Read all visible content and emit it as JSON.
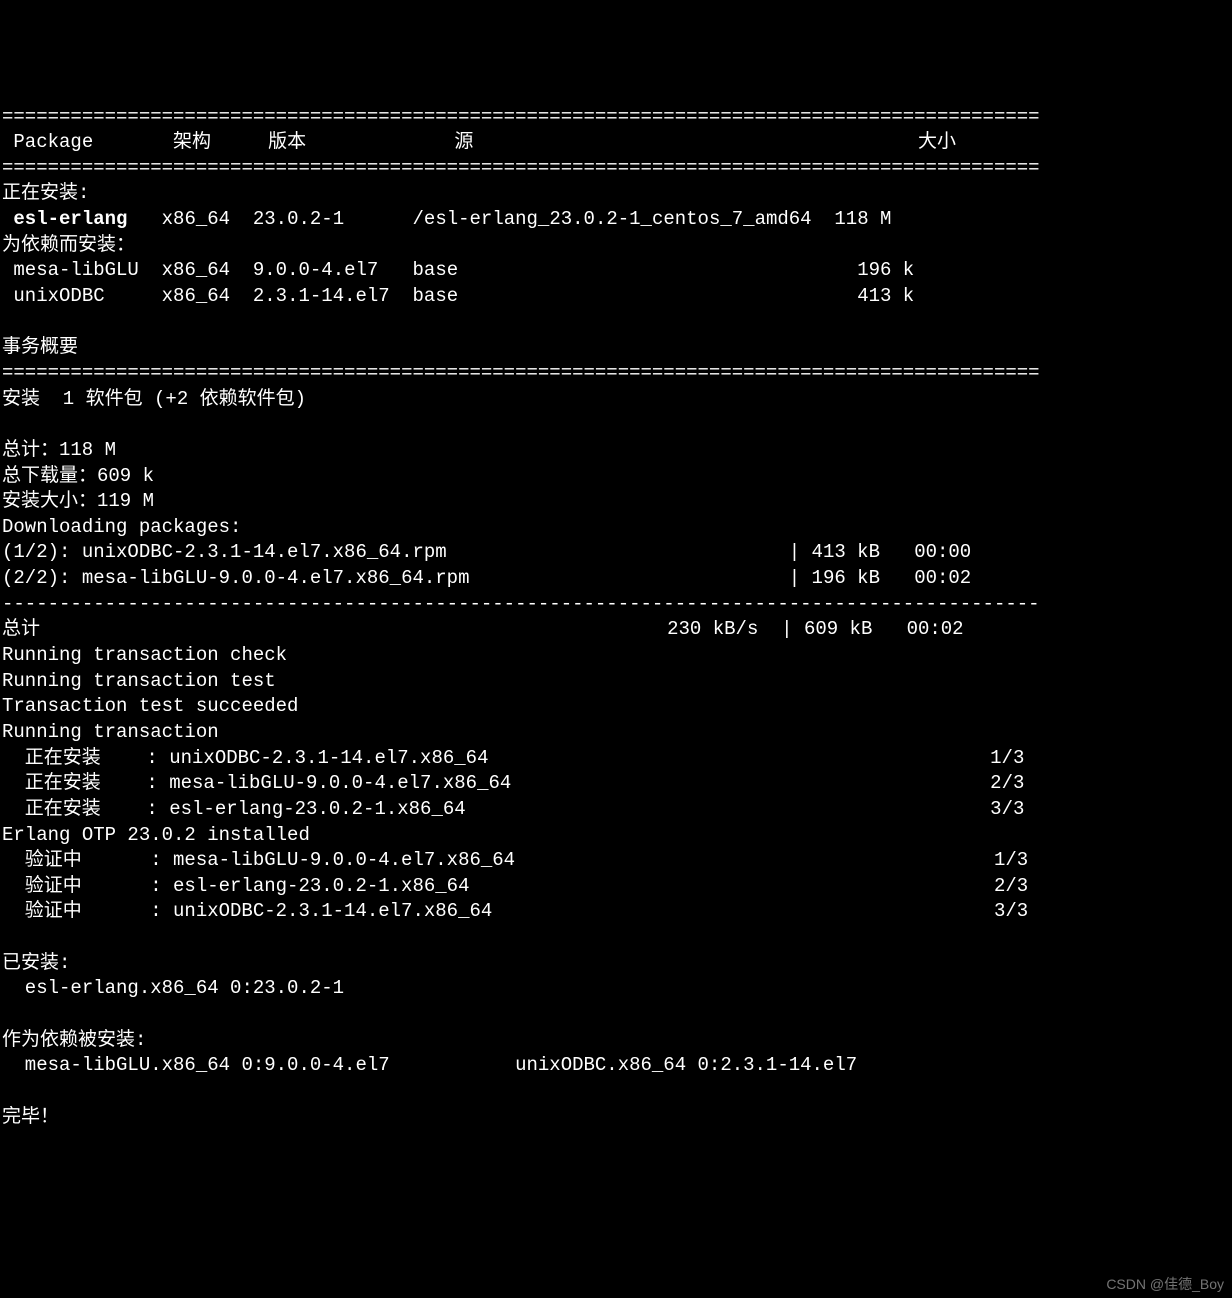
{
  "rule_double": "===========================================================================================",
  "header": {
    "package": " Package",
    "arch": "架构",
    "version": "版本",
    "repo": "源",
    "size": "大小"
  },
  "installing_label": "正在安装:",
  "pkg_main": {
    "name": " esl-erlang",
    "arch": "x86_64",
    "version": "23.0.2-1",
    "repo": "/esl-erlang_23.0.2-1_centos_7_amd64",
    "size": "118 M"
  },
  "dep_label": "为依赖而安装：",
  "dep1": {
    "name": " mesa-libGLU",
    "arch": "x86_64",
    "version": "9.0.0-4.el7",
    "repo": "base",
    "size": "196 k"
  },
  "dep2": {
    "name": " unixODBC",
    "arch": "x86_64",
    "version": "2.3.1-14.el7",
    "repo": "base",
    "size": "413 k"
  },
  "summary_label": "事务概要",
  "install_summary": "安装  1 软件包 (+2 依赖软件包)",
  "total_size": "总计：118 M",
  "total_download": "总下载量：609 k",
  "install_size": "安装大小：119 M",
  "downloading": "Downloading packages:",
  "dl1": {
    "left": "(1/2): unixODBC-2.3.1-14.el7.x86_64.rpm",
    "bar": "| 413 kB",
    "time": "00:00"
  },
  "dl2": {
    "left": "(2/2): mesa-libGLU-9.0.0-4.el7.x86_64.rpm",
    "bar": "| 196 kB",
    "time": "00:02"
  },
  "rule_dash": "-------------------------------------------------------------------------------------------",
  "total_row": {
    "label": "总计",
    "speed": "230 kB/s  | 609 kB",
    "time": "00:02"
  },
  "trans_check": "Running transaction check",
  "trans_test": "Running transaction test",
  "trans_succ": "Transaction test succeeded",
  "trans_run": "Running transaction",
  "inst1": {
    "label": "  正在安装    : unixODBC-2.3.1-14.el7.x86_64",
    "count": "1/3"
  },
  "inst2": {
    "label": "  正在安装    : mesa-libGLU-9.0.0-4.el7.x86_64",
    "count": "2/3"
  },
  "inst3": {
    "label": "  正在安装    : esl-erlang-23.0.2-1.x86_64",
    "count": "3/3"
  },
  "otp_installed": "Erlang OTP 23.0.2 installed",
  "ver1": {
    "label": "  验证中      : mesa-libGLU-9.0.0-4.el7.x86_64",
    "count": "1/3"
  },
  "ver2": {
    "label": "  验证中      : esl-erlang-23.0.2-1.x86_64",
    "count": "2/3"
  },
  "ver3": {
    "label": "  验证中      : unixODBC-2.3.1-14.el7.x86_64",
    "count": "3/3"
  },
  "installed_label": "已安装:",
  "installed_pkg": "  esl-erlang.x86_64 0:23.0.2-1",
  "dep_installed_label": "作为依赖被安装:",
  "dep_installed_line": "  mesa-libGLU.x86_64 0:9.0.0-4.el7           unixODBC.x86_64 0:2.3.1-14.el7",
  "complete": "完毕！",
  "watermark": "CSDN @佳德_Boy"
}
